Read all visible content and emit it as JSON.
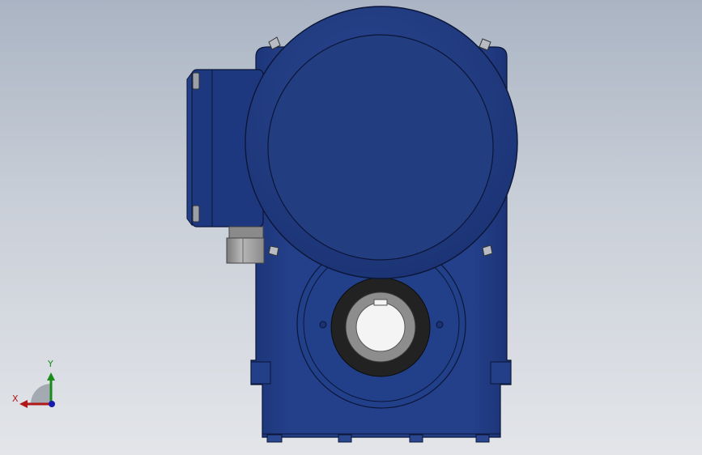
{
  "viewport": {
    "background_top": "#aab4c3",
    "background_bottom": "#e3e5e9"
  },
  "model": {
    "part": "gearbox-with-motor-adapter",
    "body_color": "#223c84",
    "body_shadow": "#182e6a",
    "hub_color": "#222222",
    "bore_color": "#8a8a8a",
    "bore_light": "#c4c4c4",
    "fitting_color": "#9c9c9c"
  },
  "triad": {
    "x_label": "X",
    "y_label": "Y",
    "x_color": "#b01818",
    "y_color": "#1a8c1a",
    "z_color": "#1a1ab0"
  }
}
